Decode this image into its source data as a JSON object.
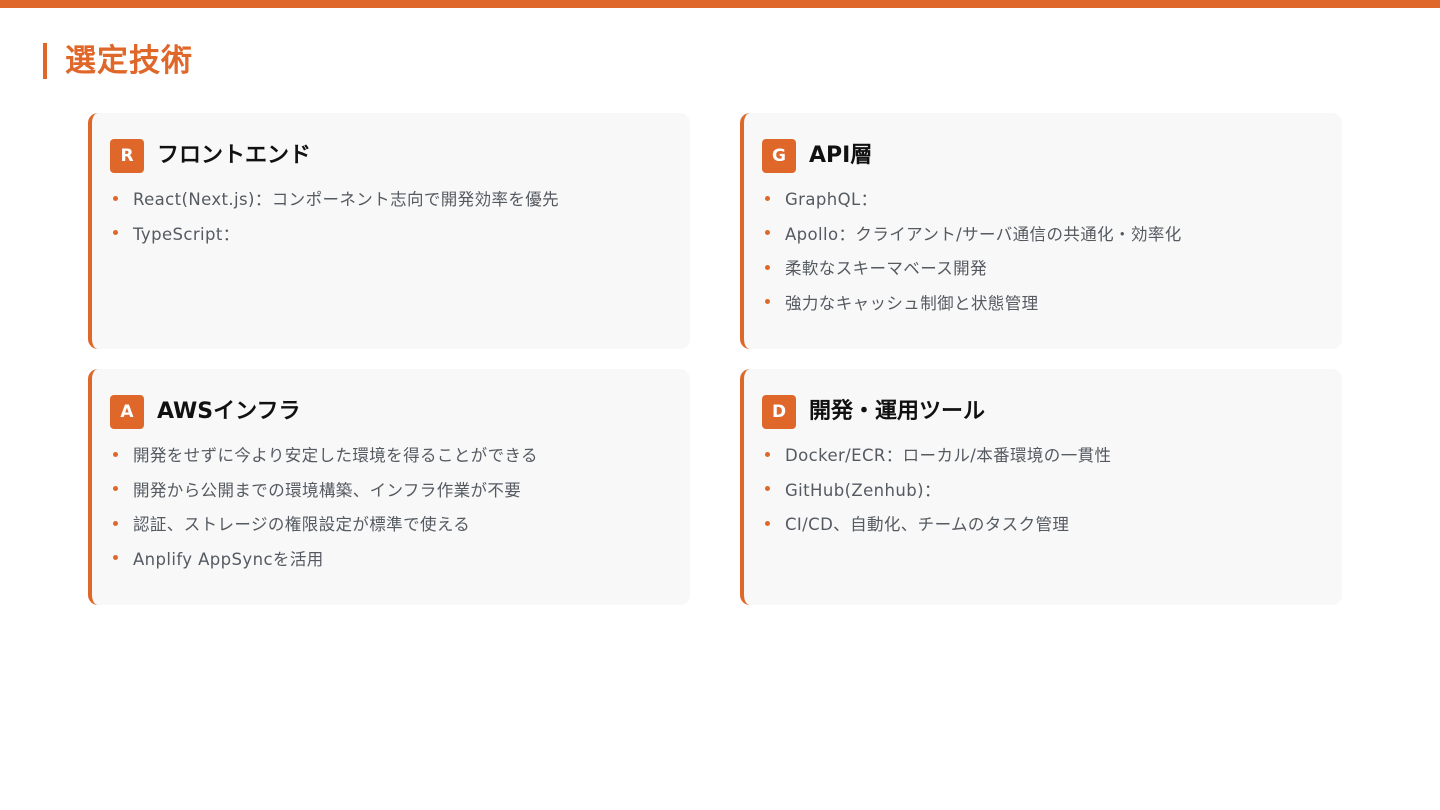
{
  "page": {
    "title": "選定技術",
    "accent_color": "#e0672a"
  },
  "cards": [
    {
      "badge": "R",
      "title": "フロントエンド",
      "items": [
        "React(Next.js)：コンポーネント志向で開発効率を優先",
        "TypeScript："
      ]
    },
    {
      "badge": "G",
      "title": "API層",
      "items": [
        "GraphQL：",
        "Apollo：クライアント/サーバ通信の共通化・効率化",
        "柔軟なスキーマベース開発",
        "強力なキャッシュ制御と状態管理"
      ]
    },
    {
      "badge": "A",
      "title": "AWSインフラ",
      "items": [
        "開発をせずに今より安定した環境を得ることができる",
        "開発から公開までの環境構築、インフラ作業が不要",
        "認証、ストレージの権限設定が標準で使える",
        "Anplify AppSyncを活用"
      ]
    },
    {
      "badge": "D",
      "title": "開発・運用ツール",
      "items": [
        "Docker/ECR：ローカル/本番環境の一貫性",
        "GitHub(Zenhub)：",
        "CI/CD、自動化、チームのタスク管理"
      ]
    }
  ]
}
